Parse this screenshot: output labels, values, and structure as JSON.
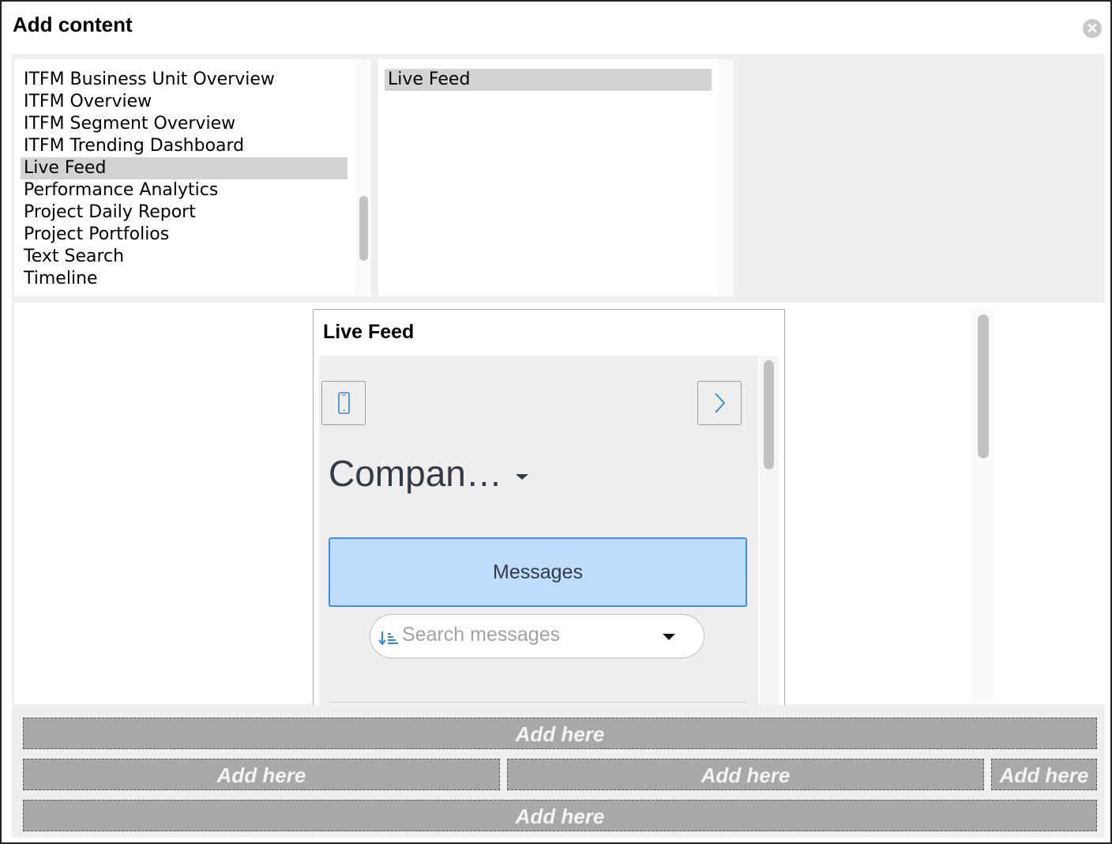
{
  "dialog": {
    "title": "Add content",
    "close_icon": "close-circle-icon"
  },
  "categories": {
    "items": [
      "ITFM Business Unit Overview",
      "ITFM Overview",
      "ITFM Segment Overview",
      "ITFM Trending Dashboard",
      "Live Feed",
      "Performance Analytics",
      "Project Daily Report",
      "Project Portfolios",
      "Text Search",
      "Timeline"
    ],
    "selected": "Live Feed"
  },
  "widgets": {
    "items": [
      "Live Feed"
    ],
    "selected": "Live Feed"
  },
  "preview": {
    "title": "Live Feed",
    "device_icon": "mobile-phone-icon",
    "next_icon": "chevron-right-icon",
    "company_label": "Compan…",
    "messages_label": "Messages",
    "search_placeholder": "Search messages",
    "sort_icon": "sort-descending-icon"
  },
  "drop_zones": {
    "row1": [
      "Add here"
    ],
    "row2": [
      "Add here",
      "Add here",
      "Add here"
    ],
    "row3": [
      "Add here"
    ]
  },
  "colors": {
    "selection": "#d3d3d3",
    "messages_bg": "#bfdcfc",
    "messages_border": "#3a8ee8",
    "accent_icon": "#2e86e0",
    "drop_zone": "#a8a8a8"
  }
}
